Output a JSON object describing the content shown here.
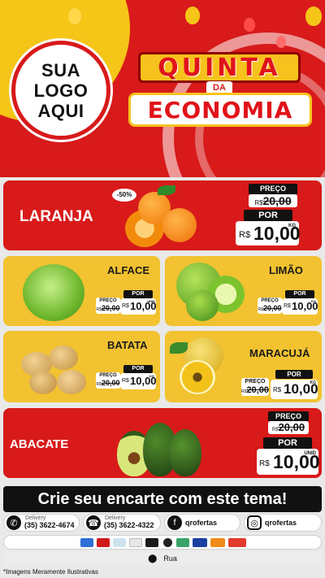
{
  "header": {
    "logo_line1": "SUA",
    "logo_line2": "LOGO",
    "logo_line3": "AQUI",
    "title_top": "QUINTA",
    "title_mid": "DA",
    "title_bottom": "ECONOMIA"
  },
  "products": {
    "laranja": {
      "name": "LARANJA",
      "discount": "-50%",
      "old_label": "PREÇO",
      "old_currency": "R$",
      "old_value": "20,00",
      "new_label": "POR",
      "new_currency": "R$",
      "new_value": "10,00",
      "unit": "KG"
    },
    "alface": {
      "name": "ALFACE",
      "new_label": "POR",
      "old_label": "PREÇO",
      "old_currency": "R$",
      "old_value": "20,00",
      "new_currency": "R$",
      "new_value": "10,00",
      "unit": "UNID"
    },
    "limao": {
      "name": "LIMÃO",
      "new_label": "POR",
      "old_label": "PREÇO",
      "old_currency": "R$",
      "old_value": "20,00",
      "new_currency": "R$",
      "new_value": "10,00",
      "unit": "KG"
    },
    "batata": {
      "name": "BATATA",
      "new_label": "POR",
      "old_label": "PREÇO",
      "old_currency": "R$",
      "old_value": "20,00",
      "new_currency": "R$",
      "new_value": "10,00",
      "unit": "KG"
    },
    "maracuja": {
      "name": "MARACUJÁ",
      "new_label": "POR",
      "old_label": "PREÇO",
      "old_currency": "R$",
      "old_value": "20,00",
      "new_currency": "R$",
      "new_value": "10,00",
      "unit": "KG"
    },
    "abacate": {
      "name": "ABACATE",
      "old_label": "PREÇO",
      "old_currency": "R$",
      "old_value": "20,00",
      "new_label": "POR",
      "new_currency": "R$",
      "new_value": "10,00",
      "unit": "UNID"
    }
  },
  "footer": {
    "banner": "Crie seu encarte com este tema!",
    "delivery_label": "Delivery",
    "phone1": "(35) 3622-4674",
    "phone2": "(35) 3622-4322",
    "facebook": "qrofertas",
    "instagram": "qrofertas",
    "address": "Rua",
    "disclaimer": "*Imagens Meramente Ilustrativas",
    "whatsapp_icon": "whatsapp-icon",
    "phone_icon": "phone-icon",
    "facebook_icon": "facebook-icon",
    "instagram_icon": "instagram-icon",
    "location_icon": "location-pin-icon"
  },
  "colors": {
    "red": "#d81a1a",
    "yellow": "#f2c230",
    "black": "#111111"
  }
}
